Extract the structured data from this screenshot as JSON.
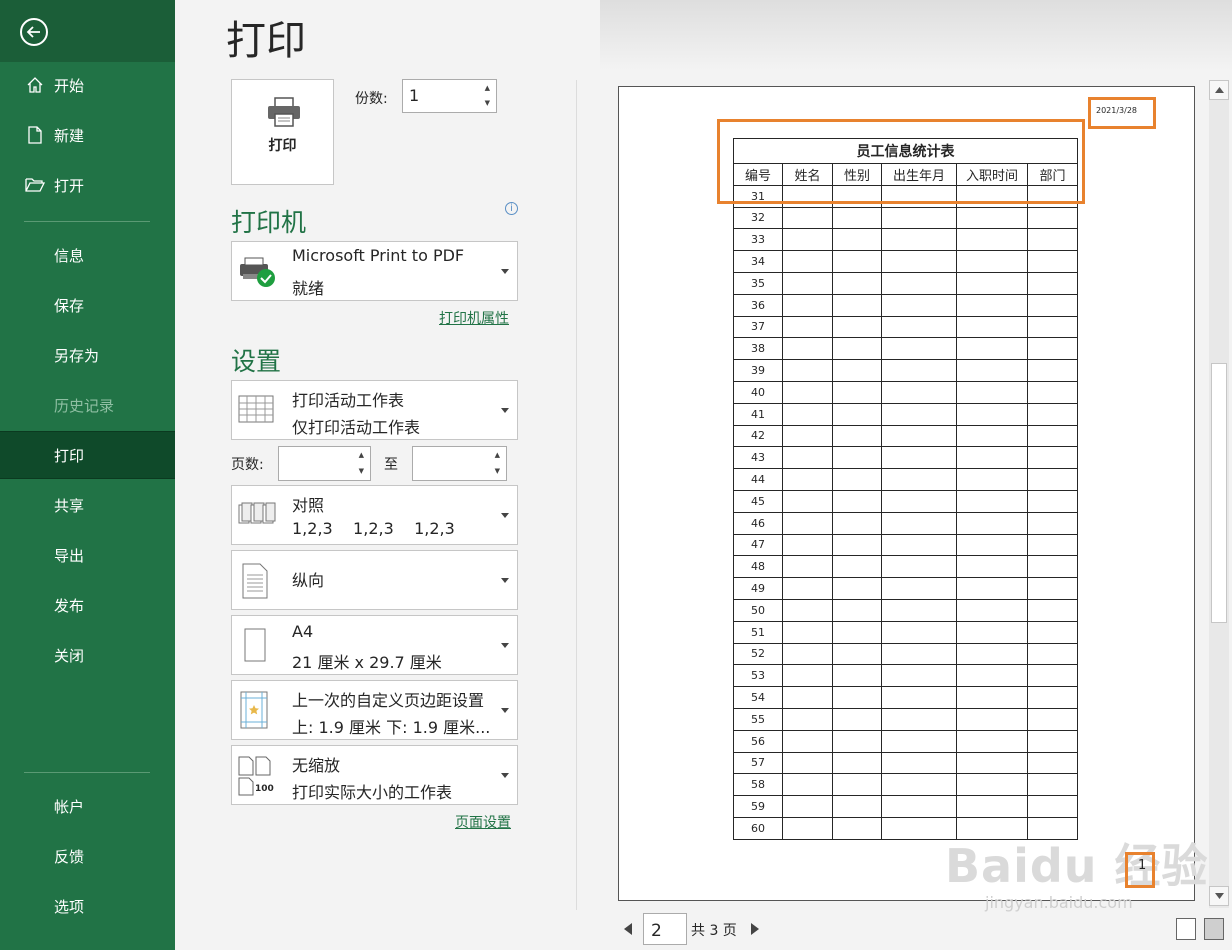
{
  "sidebar": {
    "items": [
      {
        "label": "开始",
        "icon": "home-icon"
      },
      {
        "label": "新建",
        "icon": "new-document-icon"
      },
      {
        "label": "打开",
        "icon": "open-folder-icon"
      },
      {
        "label": "信息"
      },
      {
        "label": "保存"
      },
      {
        "label": "另存为"
      },
      {
        "label": "历史记录",
        "disabled": true
      },
      {
        "label": "打印",
        "active": true
      },
      {
        "label": "共享"
      },
      {
        "label": "导出"
      },
      {
        "label": "发布"
      },
      {
        "label": "关闭"
      },
      {
        "label": "帐户"
      },
      {
        "label": "反馈"
      },
      {
        "label": "选项"
      }
    ]
  },
  "page_title": "打印",
  "print_button_label": "打印",
  "copies": {
    "label": "份数:",
    "value": "1"
  },
  "printer": {
    "section_title": "打印机",
    "name": "Microsoft Print to PDF",
    "status": "就绪",
    "properties_link": "打印机属性"
  },
  "settings": {
    "section_title": "设置",
    "print_what": {
      "title": "打印活动工作表",
      "subtitle": "仅打印活动工作表"
    },
    "pages_label": "页数:",
    "to_label": "至",
    "collate": {
      "title": "对照",
      "subtitle": "1,2,3    1,2,3    1,2,3"
    },
    "orientation": {
      "title": "纵向"
    },
    "paper": {
      "title": "A4",
      "subtitle": "21 厘米 x 29.7 厘米"
    },
    "margins": {
      "title": "上一次的自定义页边距设置",
      "subtitle": "上: 1.9 厘米 下: 1.9 厘米..."
    },
    "scaling": {
      "title": "无缩放",
      "subtitle": "打印实际大小的工作表",
      "icon_text": "100"
    },
    "page_setup_link": "页面设置"
  },
  "preview": {
    "date": "2021/3/28",
    "table_title": "员工信息统计表",
    "headers": [
      "编号",
      "姓名",
      "性别",
      "出生年月",
      "入职时间",
      "部门"
    ],
    "row_start": 31,
    "row_end": 60,
    "footer_page": "1"
  },
  "page_nav": {
    "current": "2",
    "total_text": "共 3 页"
  },
  "watermark": {
    "text": "Baidu 经验",
    "url": "jingyan.baidu.com"
  },
  "colors": {
    "sidebar": "#217346",
    "active": "#0f4a2a",
    "highlight": "#e8822e",
    "accent": "#217346"
  }
}
